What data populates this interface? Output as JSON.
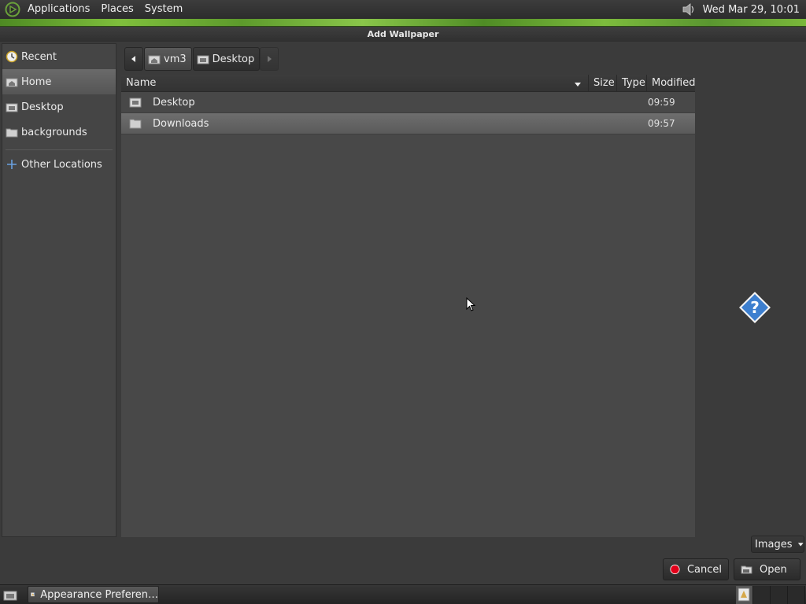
{
  "top_panel": {
    "menus": [
      "Applications",
      "Places",
      "System"
    ],
    "clock": "Wed Mar 29, 10:01",
    "icons": {
      "logo": "distro-logo-icon",
      "volume": "volume-icon"
    }
  },
  "window": {
    "title": "Add Wallpaper"
  },
  "sidebar": {
    "items": [
      {
        "label": "Recent",
        "icon": "recent-icon"
      },
      {
        "label": "Home",
        "icon": "home-folder-icon",
        "selected": true
      },
      {
        "label": "Desktop",
        "icon": "desktop-folder-icon"
      },
      {
        "label": "backgrounds",
        "icon": "folder-icon"
      }
    ],
    "other_locations": {
      "label": "Other Locations",
      "icon": "plus-icon"
    }
  },
  "path_bar": {
    "crumbs": [
      {
        "label": "vm3",
        "icon": "home-folder-icon",
        "active": true
      },
      {
        "label": "Desktop",
        "icon": "desktop-folder-icon",
        "active": false
      }
    ]
  },
  "file_list": {
    "columns": [
      "Name",
      "Size",
      "Type",
      "Modified"
    ],
    "rows": [
      {
        "name": "Desktop",
        "size": "",
        "type": "",
        "modified": "09:59",
        "icon": "desktop-folder-icon"
      },
      {
        "name": "Downloads",
        "size": "",
        "type": "",
        "modified": "09:57",
        "icon": "folder-icon",
        "selected": true
      }
    ]
  },
  "preview": {
    "icon": "help-question-icon"
  },
  "filter": {
    "value": "Images"
  },
  "buttons": {
    "cancel": "Cancel",
    "open": "Open"
  },
  "bottom_panel": {
    "task_label": "Appearance Preferen…",
    "workspaces": 4,
    "icons": {
      "show_desktop": "show-desktop-icon",
      "task": "appearance-icon"
    }
  },
  "colors": {
    "accent_green": "#7fbf3c",
    "panel_dark": "#2c2c2c",
    "dialog_bg": "#3b3b3b",
    "list_bg": "#484848",
    "cancel_red": "#e2001a"
  }
}
